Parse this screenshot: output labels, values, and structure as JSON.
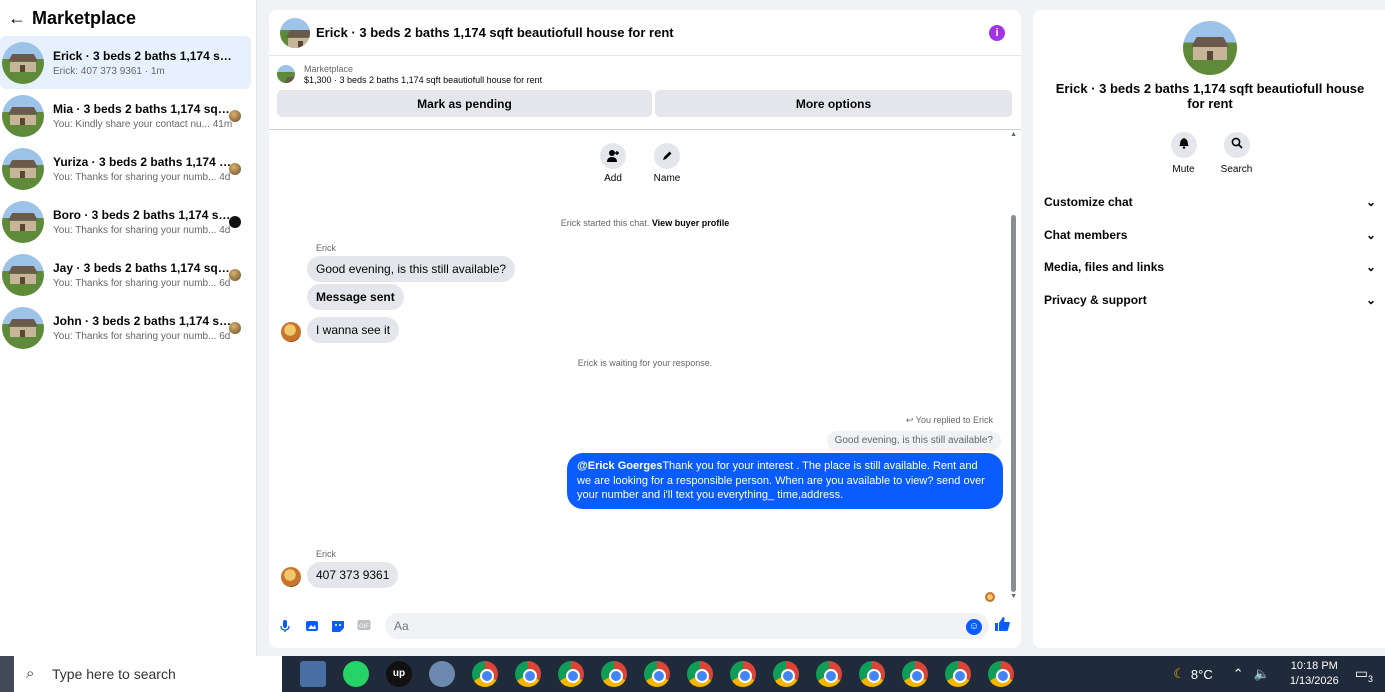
{
  "sidebar": {
    "title": "Marketplace",
    "back_icon": "arrow-left-icon",
    "conversations": [
      {
        "name": "Erick · 3 beds 2 baths 1,174 sqft be...",
        "preview": "Erick: 407 373 9361 · 1m"
      },
      {
        "name": "Mia · 3 beds 2 baths 1,174 sqft b...",
        "preview": "You: Kindly share your contact nu... 41m"
      },
      {
        "name": "Yuriza · 3 beds 2 baths 1,174 sqft...",
        "preview": "You: Thanks for sharing your numb... 4d"
      },
      {
        "name": "Boro · 3 beds 2 baths 1,174 sqft ...",
        "preview": "You: Thanks for sharing your numb... 4d"
      },
      {
        "name": "Jay · 3 beds 2 baths 1,174 sqft b...",
        "preview": "You: Thanks for sharing your numb... 6d"
      },
      {
        "name": "John · 3 beds 2 baths 1,174 sqft ...",
        "preview": "You: Thanks for sharing your numb... 6d"
      }
    ]
  },
  "chat": {
    "title": "Erick · 3 beds 2 baths 1,174 sqft beautiofull house for rent",
    "listing_source": "Marketplace",
    "listing_line": "$1,300 · 3 beds 2 baths 1,174 sqft beautiofull house for rent",
    "mark_pending": "Mark as pending",
    "more_options": "More options",
    "quick_actions": {
      "add": "Add",
      "name": "Name"
    },
    "started_text": "Erick started this chat.",
    "view_profile": "View buyer profile",
    "sender1": "Erick",
    "msg1": "Good evening, is this still available?",
    "msg2": "Message sent",
    "msg3": "I wanna see  it",
    "waiting": "Erick is waiting for your response.",
    "replied_to": "You replied to Erick",
    "quoted": "Good evening, is this still available?",
    "reply_mention": "@Erick Goerges",
    "reply_body": "Thank you for your interest . The place is still available. Rent and we are looking for a responsible person. When are you available to view? send over your number and i'll text you everything_ time,address.",
    "sender2": "Erick",
    "msg4": "407 373 9361",
    "input_placeholder": "Aa"
  },
  "right_panel": {
    "title": "Erick · 3 beds 2 baths 1,174 sqft beautiofull house for rent",
    "mute": "Mute",
    "search": "Search",
    "sections": [
      "Customize chat",
      "Chat members",
      "Media, files and links",
      "Privacy & support"
    ]
  },
  "taskbar": {
    "search_placeholder": "Type here to search",
    "temperature": "8°C",
    "time": "10:18 PM",
    "date": "1/13/2026",
    "notifications": "3"
  },
  "colors": {
    "accent": "#0a5cff",
    "info": "#a033e6",
    "active_row": "#e7f0fd"
  }
}
